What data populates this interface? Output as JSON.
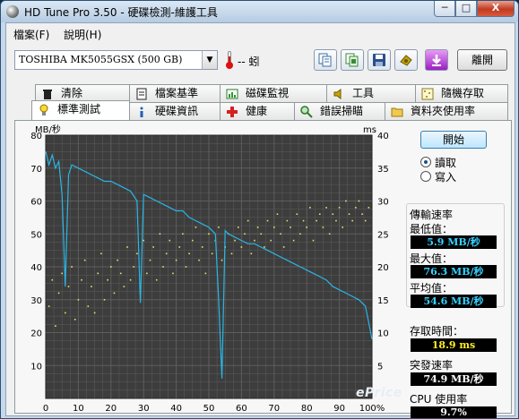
{
  "window": {
    "title": "HD Tune Pro 3.50 - 硬碟檢測-維護工具",
    "min_label": "─",
    "max_label": "□",
    "close_label": "X"
  },
  "menu": {
    "items": [
      "檔案(F)",
      "說明(H)"
    ]
  },
  "toolbar": {
    "drive": "TOSHIBA MK5055GSX (500 GB)",
    "temperature": "-- 蚓",
    "exit_label": "離開",
    "icons": [
      "copy-text-icon",
      "copy-screen-icon",
      "save-icon",
      "options-icon",
      "download-icon"
    ]
  },
  "tabs_top": [
    {
      "label": "清除",
      "icon": "trash-icon"
    },
    {
      "label": "檔案基準",
      "icon": "file-benchmark-icon"
    },
    {
      "label": "磁碟監視",
      "icon": "monitor-icon"
    },
    {
      "label": "工具",
      "icon": "speaker-icon"
    },
    {
      "label": "隨機存取",
      "icon": "random-access-icon"
    }
  ],
  "tabs_bottom": [
    {
      "label": "標準測試",
      "icon": "bulb-icon",
      "active": true
    },
    {
      "label": "硬碟資訊",
      "icon": "info-icon"
    },
    {
      "label": "健康",
      "icon": "health-cross-icon"
    },
    {
      "label": "錯誤掃瞄",
      "icon": "magnifier-icon"
    },
    {
      "label": "資料夾使用率",
      "icon": "folder-icon"
    }
  ],
  "controls": {
    "start_label": "開始",
    "read_label": "讀取",
    "write_label": "寫入",
    "selected": "read"
  },
  "stats": {
    "transfer_title": "傳輸速率",
    "min_label": "最低值：",
    "min_value": "5.9 MB/秒",
    "max_label": "最大值：",
    "max_value": "76.3 MB/秒",
    "avg_label": "平均值：",
    "avg_value": "54.6 MB/秒",
    "access_label": "存取時間：",
    "access_value": "18.9 ms",
    "burst_label": "突發速率",
    "burst_value": "74.9 MB/秒",
    "cpu_label": "CPU 使用率",
    "cpu_value": "9.7%"
  },
  "watermark": "ePrice",
  "chart_data": {
    "type": "line",
    "title": "",
    "ylabel_left": "MB/秒",
    "ylabel_right": "ms",
    "x_ticks": [
      "0",
      "10",
      "20",
      "30",
      "40",
      "50",
      "60",
      "70",
      "80",
      "90",
      "100%"
    ],
    "y_ticks_left": [
      "10",
      "20",
      "30",
      "40",
      "50",
      "60",
      "70",
      "80"
    ],
    "y_ticks_right": [
      "5",
      "10",
      "15",
      "20",
      "25",
      "30",
      "35",
      "40"
    ],
    "ylim_left": [
      0,
      80
    ],
    "ylim_right": [
      0,
      40
    ],
    "xlim": [
      0,
      100
    ],
    "grid": true,
    "colors": {
      "transfer": "#29b6e6",
      "access": "#e8e26a",
      "background": "#3d3d3d",
      "grid": "#5e5e5e"
    },
    "series": [
      {
        "name": "transfer_rate_MBps",
        "x": [
          0,
          1,
          2,
          3,
          4,
          5,
          6,
          7,
          8,
          10,
          12,
          14,
          16,
          18,
          20,
          22,
          24,
          26,
          28,
          29,
          30,
          32,
          34,
          36,
          38,
          40,
          42,
          44,
          46,
          48,
          50,
          52,
          53,
          54,
          55,
          56,
          58,
          60,
          62,
          64,
          66,
          68,
          70,
          72,
          74,
          76,
          78,
          80,
          82,
          84,
          86,
          88,
          90,
          92,
          94,
          96,
          98,
          100
        ],
        "y": [
          75,
          71,
          74,
          70,
          72,
          62,
          34,
          68,
          71,
          70,
          69,
          68,
          67,
          66,
          66,
          65,
          64,
          63,
          60,
          29,
          62,
          61,
          60,
          59,
          58,
          57,
          57,
          55,
          54,
          53,
          52,
          50,
          30,
          6,
          51,
          50,
          49,
          48,
          47,
          47,
          46,
          45,
          44,
          43,
          42,
          41,
          40,
          39,
          38,
          37,
          36,
          34,
          33,
          32,
          31,
          30,
          28,
          18
        ]
      },
      {
        "name": "access_time_ms",
        "type": "scatter",
        "x": [
          1,
          2,
          3,
          4,
          5,
          6,
          7,
          8,
          9,
          10,
          11,
          12,
          13,
          14,
          15,
          16,
          17,
          18,
          19,
          20,
          21,
          22,
          23,
          24,
          25,
          26,
          27,
          28,
          29,
          30,
          31,
          32,
          33,
          34,
          35,
          36,
          37,
          38,
          39,
          40,
          41,
          42,
          43,
          44,
          45,
          46,
          47,
          48,
          49,
          50,
          51,
          52,
          53,
          54,
          55,
          56,
          57,
          58,
          59,
          60,
          61,
          62,
          63,
          64,
          65,
          66,
          67,
          68,
          69,
          70,
          71,
          72,
          73,
          74,
          75,
          76,
          77,
          78,
          79,
          80,
          81,
          82,
          83,
          84,
          85,
          86,
          87,
          88,
          89,
          90,
          91,
          92,
          93,
          94,
          95,
          96,
          97,
          98,
          99
        ],
        "y": [
          14,
          18,
          11,
          16,
          19,
          13,
          17,
          20,
          12,
          15,
          18,
          21,
          14,
          17,
          13,
          19,
          22,
          15,
          18,
          20,
          16,
          21,
          19,
          17,
          23,
          18,
          20,
          22,
          16,
          24,
          19,
          21,
          23,
          18,
          25,
          20,
          22,
          24,
          19,
          21,
          23,
          25,
          20,
          22,
          24,
          26,
          21,
          23,
          19,
          25,
          22,
          24,
          26,
          21,
          23,
          25,
          22,
          24,
          26,
          23,
          25,
          27,
          22,
          24,
          26,
          25,
          23,
          27,
          24,
          26,
          28,
          25,
          23,
          27,
          26,
          24,
          28,
          25,
          27,
          26,
          29,
          24,
          27,
          28,
          26,
          29,
          25,
          28,
          27,
          29,
          26,
          30,
          28,
          27,
          29,
          30,
          28,
          27,
          29
        ]
      }
    ]
  }
}
